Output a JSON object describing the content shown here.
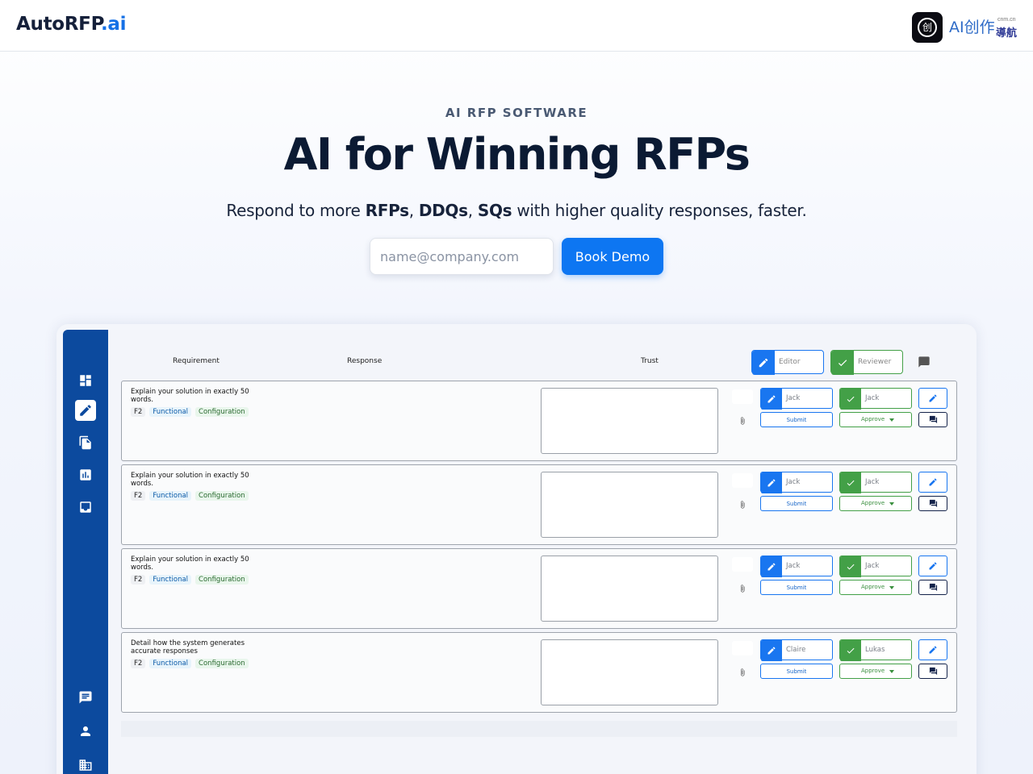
{
  "header": {
    "logo_main": "AutoRFP",
    "logo_suffix": ".ai",
    "badge_text": "AI创作",
    "badge_sub": "導航",
    "badge_tiny": "cnm.cn",
    "badge_mark": "创"
  },
  "hero": {
    "kicker": "AI RFP SOFTWARE",
    "title": "AI for Winning RFPs",
    "subtitle_prefix": "Respond to more ",
    "subtitle_b1": "RFPs",
    "subtitle_sep1": ", ",
    "subtitle_b2": "DDQs",
    "subtitle_sep2": ", ",
    "subtitle_b3": "SQs",
    "subtitle_suffix": " with higher quality responses, faster.",
    "email_placeholder": "name@company.com",
    "cta_label": "Book Demo"
  },
  "sidebar": {
    "top_icons": [
      "dashboard-icon",
      "edit-icon",
      "documents-icon",
      "analytics-icon",
      "inbox-icon"
    ],
    "bottom_icons": [
      "chat-icon",
      "user-icon",
      "company-icon"
    ],
    "active": "edit-icon"
  },
  "table": {
    "columns": {
      "requirement": "Requirement",
      "response": "Response",
      "trust": "Trust"
    },
    "editor_label": "Editor",
    "reviewer_label": "Reviewer",
    "rows": [
      {
        "requirement": "Explain your solution in exactly 50 words.",
        "tags": [
          "F2",
          "Functional",
          "Configuration"
        ],
        "editor": "Jack",
        "reviewer": "Jack",
        "submit": "Submit",
        "approve": "Approve"
      },
      {
        "requirement": "Explain your solution in exactly 50 words.",
        "tags": [
          "F2",
          "Functional",
          "Configuration"
        ],
        "editor": "Jack",
        "reviewer": "Jack",
        "submit": "Submit",
        "approve": "Approve"
      },
      {
        "requirement": "Explain your solution in exactly 50 words.",
        "tags": [
          "F2",
          "Functional",
          "Configuration"
        ],
        "editor": "Jack",
        "reviewer": "Jack",
        "submit": "Submit",
        "approve": "Approve"
      },
      {
        "requirement": "Detail how the system generates accurate responses",
        "tags": [
          "F2",
          "Functional",
          "Configuration"
        ],
        "editor": "Claire",
        "reviewer": "Lukas",
        "submit": "Submit",
        "approve": "Approve"
      }
    ]
  },
  "colors": {
    "brand_blue": "#1671e6",
    "cta_blue": "#0d76f2",
    "sidebar": "#0c4a9e",
    "editor": "#1976f0",
    "reviewer": "#43a047"
  }
}
